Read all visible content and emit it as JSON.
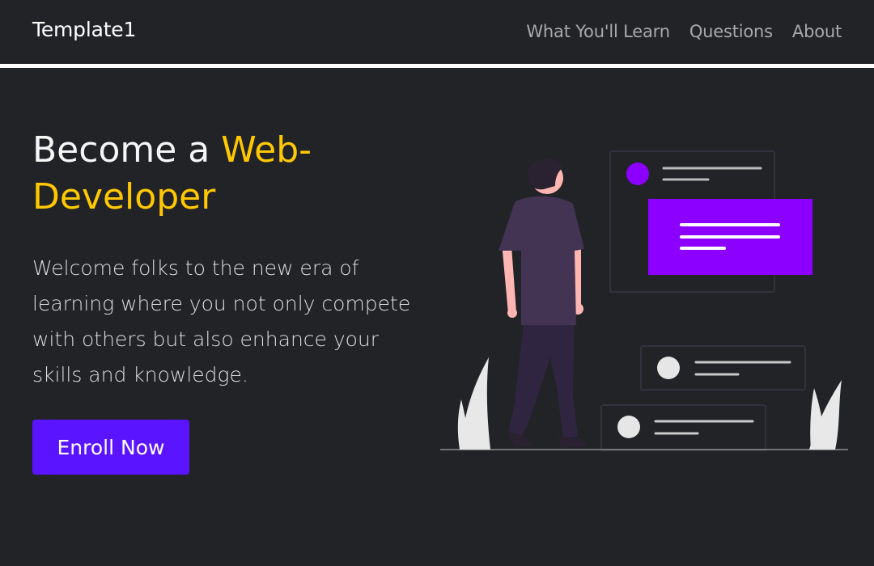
{
  "navbar": {
    "brand": "Template1",
    "links": [
      "What You'll Learn",
      "Questions",
      "About"
    ]
  },
  "hero": {
    "title_prefix": "Become a ",
    "title_accent": "Web-Developer",
    "description": "Welcome folks to the new era of learning where you not only compete with others but also enhance your skills and knowledge.",
    "cta_label": "Enroll Now"
  },
  "colors": {
    "background": "#212327",
    "accent_yellow": "#ffc800",
    "button_purple": "#5b14ff",
    "illustration_purple": "#8c00ff"
  },
  "illustration": {
    "icon": "person-looking-at-cards-illustration"
  }
}
